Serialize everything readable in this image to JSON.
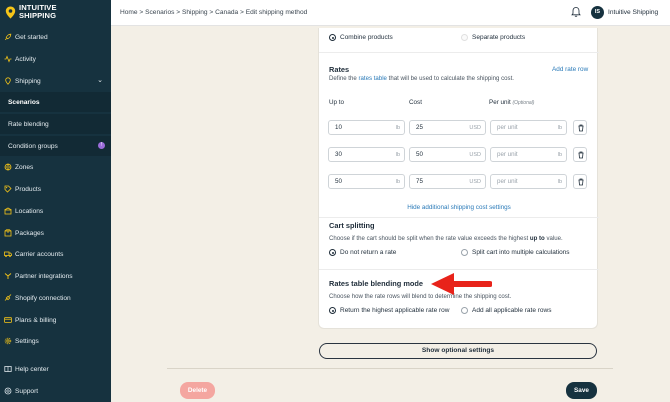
{
  "brand": {
    "line1": "INTUITIVE",
    "line2": "SHIPPING",
    "accent": "#f5c518"
  },
  "sidebar": {
    "items": [
      {
        "label": "Get started",
        "icon": "rocket-icon"
      },
      {
        "label": "Activity",
        "icon": "activity-icon"
      },
      {
        "label": "Shipping",
        "icon": "shipping-icon"
      },
      {
        "label": "Scenarios"
      },
      {
        "label": "Rate blending"
      },
      {
        "label": "Condition groups",
        "badge": "!"
      },
      {
        "label": "Zones",
        "icon": "zones-icon"
      },
      {
        "label": "Products",
        "icon": "products-icon"
      },
      {
        "label": "Locations",
        "icon": "locations-icon"
      },
      {
        "label": "Packages",
        "icon": "packages-icon"
      },
      {
        "label": "Carrier accounts",
        "icon": "carrier-icon"
      },
      {
        "label": "Partner integrations",
        "icon": "partner-icon"
      },
      {
        "label": "Shopify connection",
        "icon": "shopify-icon"
      },
      {
        "label": "Plans & billing",
        "icon": "billing-icon"
      },
      {
        "label": "Settings",
        "icon": "gear-icon"
      },
      {
        "label": "Help center",
        "icon": "help-icon"
      },
      {
        "label": "Support",
        "icon": "support-icon"
      }
    ]
  },
  "topbar": {
    "breadcrumb": "Home > Scenarios > Shipping > Canada > Edit shipping method",
    "user_initials": "IS",
    "user_name": "Intuitive Shipping"
  },
  "combine": {
    "combine_label": "Combine products",
    "separate_label": "Separate products",
    "selected": "combine"
  },
  "rates": {
    "title": "Rates",
    "desc_pre": "Define the ",
    "desc_link": "rates table",
    "desc_post": " that will be used to calculate the shipping cost.",
    "add_row": "Add rate row",
    "col_upto": "Up to",
    "col_cost": "Cost",
    "col_perunit": "Per unit",
    "col_optional": "(Optional)",
    "rows": [
      {
        "upto": "10",
        "upto_unit": "lb",
        "cost": "25",
        "cost_unit": "USD",
        "per_unit_ph": "per unit",
        "per_unit_unit": "lb"
      },
      {
        "upto": "30",
        "upto_unit": "lb",
        "cost": "50",
        "cost_unit": "USD",
        "per_unit_ph": "per unit",
        "per_unit_unit": "lb"
      },
      {
        "upto": "50",
        "upto_unit": "lb",
        "cost": "75",
        "cost_unit": "USD",
        "per_unit_ph": "per unit",
        "per_unit_unit": "lb"
      }
    ],
    "hide_link": "Hide additional shipping cost settings"
  },
  "cart": {
    "title": "Cart splitting",
    "desc_pre": "Choose if the cart should be split when the rate value exceeds the highest ",
    "desc_bold": "up to",
    "desc_post": " value.",
    "opt1": "Do not return a rate",
    "opt2": "Split cart into multiple calculations",
    "selected": "opt1"
  },
  "blend": {
    "title": "Rates table blending mode",
    "desc": "Choose how the rate rows will blend to determine the shipping cost.",
    "opt1": "Return the highest applicable rate row",
    "opt2": "Add all applicable rate rows",
    "selected": "opt1"
  },
  "buttons": {
    "optional": "Show optional settings",
    "delete": "Delete",
    "save": "Save"
  },
  "colors": {
    "sidebar": "#16323f",
    "arrow": "#e8231a",
    "delete": "#f4a6a0",
    "link": "#2a7ab8"
  }
}
